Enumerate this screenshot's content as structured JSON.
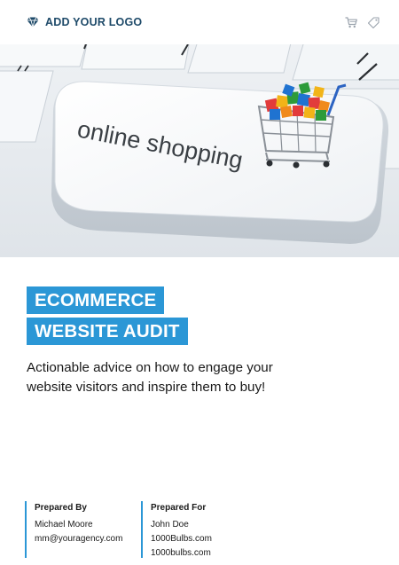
{
  "header": {
    "logo_text": "ADD YOUR LOGO",
    "logo_icon": "diamond-icon",
    "icons": [
      "cart-icon",
      "tag-icon"
    ]
  },
  "hero": {
    "key_text": "online shopping"
  },
  "title": {
    "line1": "ECOMMERCE",
    "line2": "WEBSITE AUDIT"
  },
  "subtitle": "Actionable advice on how to engage your website visitors and inspire them to buy!",
  "prepared_by": {
    "heading": "Prepared By",
    "name": "Michael Moore",
    "email": "mm@youragency.com"
  },
  "prepared_for": {
    "heading": "Prepared For",
    "name": "John Doe",
    "company": "1000Bulbs.com",
    "website": "1000bulbs.com"
  },
  "colors": {
    "accent": "#2b97d6",
    "logo_text": "#1e4a69"
  }
}
